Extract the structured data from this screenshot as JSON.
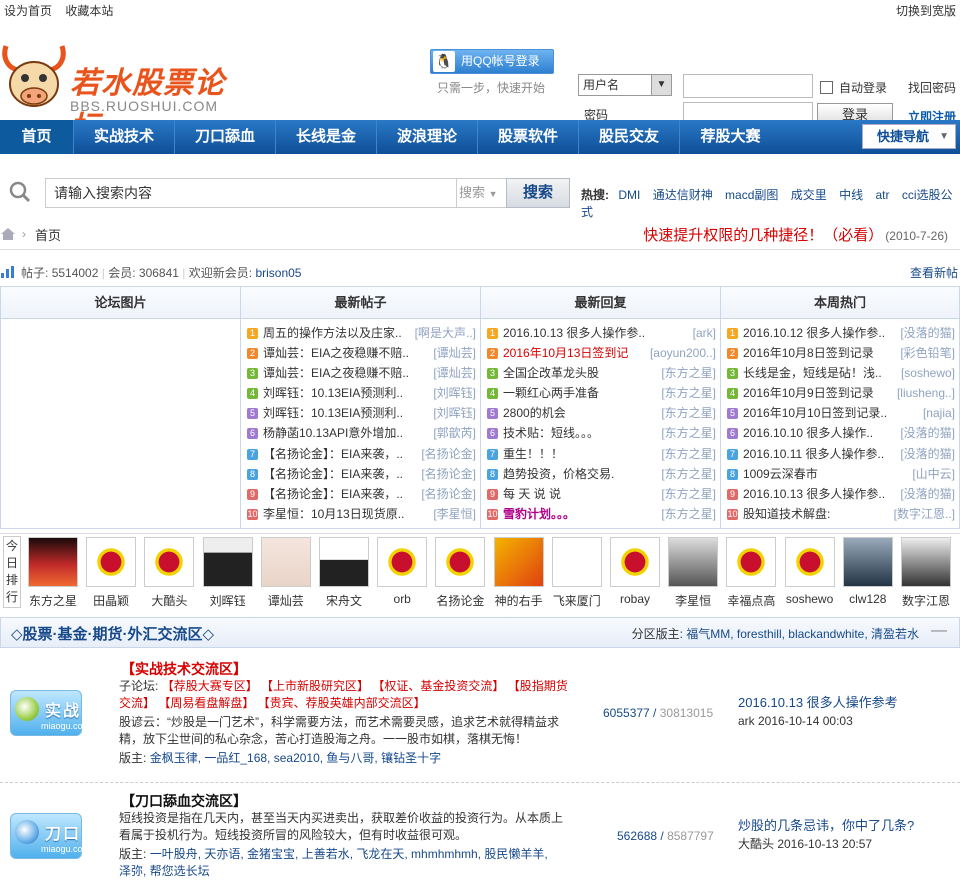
{
  "topbar": {
    "set_home": "设为首页",
    "bookmark": "收藏本站",
    "switch_wide": "切换到宽版"
  },
  "logo": {
    "title": "若水股票论坛",
    "domain": "BBS.RUOSHUI.COM"
  },
  "login": {
    "qq_button": "用QQ帐号登录",
    "qq_tip": "只需一步，快速开始",
    "username_type": "用户名",
    "password_label": "密码",
    "auto_login": "自动登录",
    "login_button": "登录",
    "find_password": "找回密码",
    "register": "立即注册"
  },
  "nav": {
    "items": [
      "首页",
      "实战技术",
      "刀口舔血",
      "长线是金",
      "波浪理论",
      "股票软件",
      "股民交友",
      "荐股大赛"
    ],
    "quick_nav": "快捷导航"
  },
  "search": {
    "placeholder": "请输入搜索内容",
    "type": "搜索",
    "button": "搜索",
    "hot_label": "热搜:",
    "hot_terms": [
      "DMI",
      "通达信财神",
      "macd副图",
      "成交里",
      "中线",
      "atr",
      "cci选股公式"
    ]
  },
  "breadcrumb": {
    "current": "首页"
  },
  "notice": {
    "text": "快速提升权限的几种捷径！（必看）",
    "date": "(2010-7-26)"
  },
  "stats": {
    "posts_label": "帖子:",
    "posts": "5514002",
    "members_label": "会员:",
    "members": "306841",
    "welcome": "欢迎新会员:",
    "new_member": "brison05",
    "view_new": "查看新帖"
  },
  "columns": [
    {
      "header": "论坛图片",
      "items": []
    },
    {
      "header": "最新帖子",
      "items": [
        {
          "t": "周五的操作方法以及庄家..",
          "u": "[啊是大声..]"
        },
        {
          "t": "谭灿芸：EIA之夜稳赚不赔..",
          "u": "[谭灿芸]"
        },
        {
          "t": "谭灿芸：EIA之夜稳赚不赔..",
          "u": "[谭灿芸]"
        },
        {
          "t": "刘晖钰：10.13EIA预测利..",
          "u": "[刘晖钰]"
        },
        {
          "t": "刘晖钰：10.13EIA预测利..",
          "u": "[刘晖钰]"
        },
        {
          "t": "杨静菡10.13API意外增加..",
          "u": "[郭歆芮]"
        },
        {
          "t": "【名扬论金】：EIA来袭，..",
          "u": "[名扬论金]"
        },
        {
          "t": "【名扬论金】：EIA来袭，..",
          "u": "[名扬论金]"
        },
        {
          "t": "【名扬论金】：EIA来袭，..",
          "u": "[名扬论金]"
        },
        {
          "t": "李星恒：10月13日现货原..",
          "u": "[李星恒]"
        }
      ]
    },
    {
      "header": "最新回复",
      "items": [
        {
          "t": "2016.10.13 很多人操作参..",
          "u": "[ark]"
        },
        {
          "t": "2016年10月13日签到记",
          "u": "[aoyun200..]"
        },
        {
          "t": "全国企改革龙头股",
          "u": "[东方之星]"
        },
        {
          "t": "一颗红心两手准备",
          "u": "[东方之星]"
        },
        {
          "t": "2800的机会",
          "u": "[东方之星]"
        },
        {
          "t": "技术贴：短线。。。",
          "u": "[东方之星]"
        },
        {
          "t": "重生！！！",
          "u": "[东方之星]"
        },
        {
          "t": "趋势投资，价格交易.",
          "u": "[东方之星]"
        },
        {
          "t": "每 天 说 说",
          "u": "[东方之星]"
        },
        {
          "t": "雪豹计划。。。",
          "u": "[东方之星]"
        }
      ]
    },
    {
      "header": "本周热门",
      "items": [
        {
          "t": "2016.10.12 很多人操作参..",
          "u": "[没落的猫]"
        },
        {
          "t": "2016年10月8日签到记录",
          "u": "[彩色铅笔]"
        },
        {
          "t": "长线是金，短线是砧！浅..",
          "u": "[soshewo]"
        },
        {
          "t": "2016年10月9日签到记录",
          "u": "[liusheng..]"
        },
        {
          "t": "2016年10月10日签到记录..",
          "u": "[najia]"
        },
        {
          "t": "2016.10.10 很多人操作..",
          "u": "[没落的猫]"
        },
        {
          "t": "2016.10.11 很多人操作参..",
          "u": "[没落的猫]"
        },
        {
          "t": "1009云深春市",
          "u": "[山中云]"
        },
        {
          "t": "2016.10.13 很多人操作参..",
          "u": "[没落的猫]"
        },
        {
          "t": "股知道技术解盘:",
          "u": "[数字江恩..]"
        }
      ]
    }
  ],
  "today": {
    "label": "今日排行",
    "users": [
      "东方之星",
      "田晶颖",
      "大酷头",
      "刘晖钰",
      "谭灿芸",
      "宋舟文",
      "orb",
      "名扬论金",
      "神的右手",
      "飞来厦门",
      "robay",
      "李星恒",
      "幸福点高",
      "soshewo",
      "clw128",
      "数字江恩"
    ]
  },
  "section": {
    "title": "◇股票·基金·期货·外汇交流区◇",
    "mods_label": "分区版主:",
    "mods": "福气MM, foresthill, blackandwhite, 清盈若水",
    "collapse": "—"
  },
  "forums": [
    {
      "icon_label": "实战",
      "icon_domain": "miaogu.com",
      "name": "【实战技术交流区】",
      "sub_label": "子论坛:",
      "subs": "【荐股大赛专区】 【上市新股研究区】 【权证、基金投资交流】 【股指期货交流】 【周易看盘解盘】 【贵宾、荐股英雄内部交流区】",
      "desc": "股谚云：“炒股是一门艺术”，科学需要方法，而艺术需要灵感，追求艺术就得精益求精，放下尘世间的私心杂念，苦心打造股海之舟。一一股市如棋，落棋无悔！",
      "mod_label": "版主:",
      "mods": "金枫玉律, 一品红_168, sea2010, 鱼与八哥, 镶钻圣十字",
      "threads": "6055377",
      "posts": "30813015",
      "last_title": "2016.10.13 很多人操作参考",
      "last_user_time": "ark 2016-10-14 00:03"
    },
    {
      "icon_label": "刀口",
      "icon_domain": "miaogu.com",
      "name": "【刀口舔血交流区】",
      "desc": "短线投资是指在几天内，甚至当天内买进卖出，获取差价收益的投资行为。从本质上看属于投机行为。短线投资所冒的风险较大，但有时收益很可观。",
      "mod_label": "版主:",
      "mods": "一叶股舟, 天亦语, 金猪宝宝, 上善若水, 飞龙在天, mhmhmhmh, 股民懒羊羊,",
      "mods2": "泽弥, 帮您选长坛",
      "threads": "562688",
      "posts": "8587797",
      "last_title": "炒股的几条忌讳，你中了几条?",
      "last_user_time": "大酷头 2016-10-13 20:57"
    }
  ]
}
